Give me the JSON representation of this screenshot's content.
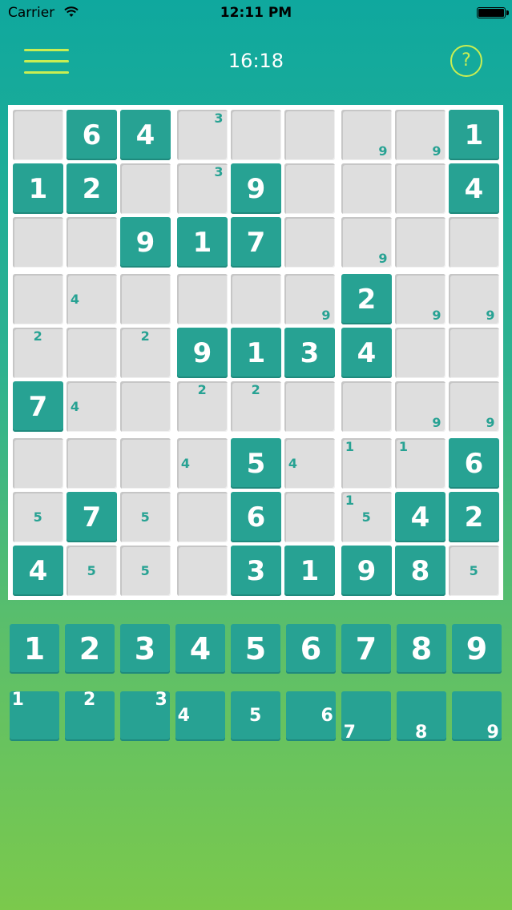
{
  "status_bar": {
    "carrier": "Carrier",
    "time": "12:11 PM"
  },
  "header": {
    "timer": "16:18",
    "help_symbol": "?",
    "menu_icon": "hamburger-icon",
    "help_icon": "question-circle-icon"
  },
  "colors": {
    "given_cell": "#27a293",
    "empty_cell": "#dedede",
    "note_text": "#27a293",
    "accent": "#c9ee52"
  },
  "board": {
    "rows": [
      [
        {
          "v": ""
        },
        {
          "v": "6"
        },
        {
          "v": "4"
        },
        {
          "v": "",
          "n": [
            3
          ]
        },
        {
          "v": ""
        },
        {
          "v": ""
        },
        {
          "v": "",
          "n": [
            9
          ]
        },
        {
          "v": "",
          "n": [
            9
          ]
        },
        {
          "v": "1"
        }
      ],
      [
        {
          "v": "1"
        },
        {
          "v": "2"
        },
        {
          "v": ""
        },
        {
          "v": "",
          "n": [
            3
          ]
        },
        {
          "v": "9"
        },
        {
          "v": ""
        },
        {
          "v": ""
        },
        {
          "v": ""
        },
        {
          "v": "4"
        }
      ],
      [
        {
          "v": ""
        },
        {
          "v": ""
        },
        {
          "v": "9"
        },
        {
          "v": "1"
        },
        {
          "v": "7"
        },
        {
          "v": ""
        },
        {
          "v": "",
          "n": [
            9
          ]
        },
        {
          "v": ""
        },
        {
          "v": ""
        }
      ],
      [
        {
          "v": ""
        },
        {
          "v": "",
          "n": [
            4
          ]
        },
        {
          "v": ""
        },
        {
          "v": ""
        },
        {
          "v": ""
        },
        {
          "v": "",
          "n": [
            9
          ]
        },
        {
          "v": "2"
        },
        {
          "v": "",
          "n": [
            9
          ]
        },
        {
          "v": "",
          "n": [
            9
          ]
        }
      ],
      [
        {
          "v": "",
          "n": [
            2
          ]
        },
        {
          "v": ""
        },
        {
          "v": "",
          "n": [
            2
          ]
        },
        {
          "v": "9"
        },
        {
          "v": "1"
        },
        {
          "v": "3"
        },
        {
          "v": "4"
        },
        {
          "v": ""
        },
        {
          "v": ""
        }
      ],
      [
        {
          "v": "7"
        },
        {
          "v": "",
          "n": [
            4
          ]
        },
        {
          "v": ""
        },
        {
          "v": "",
          "n": [
            2
          ]
        },
        {
          "v": "",
          "n": [
            2
          ]
        },
        {
          "v": ""
        },
        {
          "v": ""
        },
        {
          "v": "",
          "n": [
            9
          ]
        },
        {
          "v": "",
          "n": [
            9
          ]
        }
      ],
      [
        {
          "v": ""
        },
        {
          "v": ""
        },
        {
          "v": ""
        },
        {
          "v": "",
          "n": [
            4
          ]
        },
        {
          "v": "5"
        },
        {
          "v": "",
          "n": [
            4
          ]
        },
        {
          "v": "",
          "n": [
            1
          ]
        },
        {
          "v": "",
          "n": [
            1
          ]
        },
        {
          "v": "6"
        }
      ],
      [
        {
          "v": "",
          "n": [
            5
          ]
        },
        {
          "v": "7"
        },
        {
          "v": "",
          "n": [
            5
          ]
        },
        {
          "v": ""
        },
        {
          "v": "6"
        },
        {
          "v": ""
        },
        {
          "v": "",
          "n": [
            1,
            5
          ]
        },
        {
          "v": "4"
        },
        {
          "v": "2"
        }
      ],
      [
        {
          "v": "4"
        },
        {
          "v": "",
          "n": [
            5
          ]
        },
        {
          "v": "",
          "n": [
            5
          ]
        },
        {
          "v": ""
        },
        {
          "v": "3"
        },
        {
          "v": "1"
        },
        {
          "v": "9"
        },
        {
          "v": "8"
        },
        {
          "v": "",
          "n": [
            5
          ]
        }
      ]
    ]
  },
  "number_pad": [
    "1",
    "2",
    "3",
    "4",
    "5",
    "6",
    "7",
    "8",
    "9"
  ],
  "notes_pad": [
    "1",
    "2",
    "3",
    "4",
    "5",
    "6",
    "7",
    "8",
    "9"
  ]
}
